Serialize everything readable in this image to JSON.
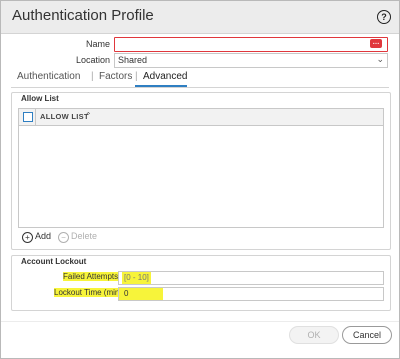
{
  "dialog": {
    "title": "Authentication Profile",
    "help_glyph": "?"
  },
  "form": {
    "name_label": "Name",
    "name_value": "",
    "name_error_glyph": "…",
    "location_label": "Location",
    "location_value": "Shared"
  },
  "tabs": [
    {
      "label": "Authentication"
    },
    {
      "label": "Factors"
    },
    {
      "label": "Advanced",
      "active": true
    }
  ],
  "allow_list": {
    "section_title": "Allow List",
    "column_header": "ALLOW LIST",
    "rows": [],
    "add_label": "Add",
    "delete_label": "Delete"
  },
  "account_lockout": {
    "section_title": "Account Lockout",
    "failed_attempts_label": "Failed Attempts",
    "failed_attempts_placeholder": "[0 - 10]",
    "lockout_time_label": "Lockout Time (min)",
    "lockout_time_value": "0"
  },
  "footer": {
    "ok_label": "OK",
    "cancel_label": "Cancel"
  },
  "colors": {
    "accent": "#2f7fc2",
    "error": "#e0373c",
    "highlight": "#f7f43a"
  }
}
